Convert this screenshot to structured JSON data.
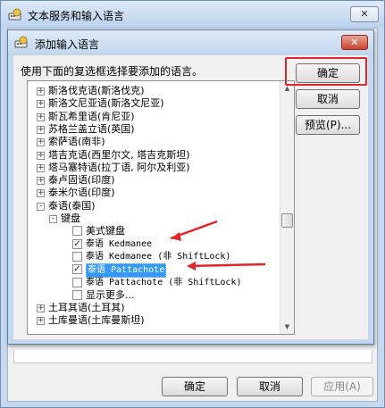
{
  "outer_window": {
    "title": "文本服务和输入语言",
    "close_glyph": "✕",
    "buttons": {
      "ok": "确定",
      "cancel": "取消",
      "apply": "应用(A)"
    }
  },
  "dialog": {
    "title": "添加输入语言",
    "close_glyph": "✕",
    "instruction": "使用下面的复选框选择要添加的语言。",
    "buttons": {
      "ok": "确定",
      "cancel": "取消",
      "preview": "预览(P)..."
    },
    "tree": [
      {
        "label": "斯洛伐克语(斯洛伐克)",
        "level": 0,
        "expander": "+"
      },
      {
        "label": "斯洛文尼亚语(斯洛文尼亚)",
        "level": 0,
        "expander": "+"
      },
      {
        "label": "斯瓦希里语(肯尼亚)",
        "level": 0,
        "expander": "+"
      },
      {
        "label": "苏格兰盖立语(英国)",
        "level": 0,
        "expander": "+"
      },
      {
        "label": "索萨语(南非)",
        "level": 0,
        "expander": "+"
      },
      {
        "label": "塔吉克语(西里尔文, 塔吉克斯坦)",
        "level": 0,
        "expander": "+"
      },
      {
        "label": "塔马塞特语(拉丁语, 阿尔及利亚)",
        "level": 0,
        "expander": "+"
      },
      {
        "label": "泰卢固语(印度)",
        "level": 0,
        "expander": "+"
      },
      {
        "label": "泰米尔语(印度)",
        "level": 0,
        "expander": "+"
      },
      {
        "label": "泰语(泰国)",
        "level": 0,
        "expander": "-"
      },
      {
        "label": "键盘",
        "level": 1,
        "expander": "-"
      },
      {
        "label": "美式键盘",
        "level": 2,
        "checked": false
      },
      {
        "label": "泰语 Kedmanee",
        "level": 2,
        "checked": true
      },
      {
        "label": "泰语 Kedmanee (非 ShiftLock)",
        "level": 2,
        "checked": false
      },
      {
        "label": "泰语 Pattachote",
        "level": 2,
        "checked": true,
        "selected": true
      },
      {
        "label": "泰语 Pattachote (非 ShiftLock)",
        "level": 2,
        "checked": false
      },
      {
        "label": "显示更多...",
        "level": 2,
        "checked": false
      },
      {
        "label": "土耳其语(土耳其)",
        "level": 0,
        "expander": "+"
      },
      {
        "label": "土库曼语(土库曼斯坦)",
        "level": 0,
        "expander": "+"
      }
    ]
  },
  "icons": {
    "window": "keyboard-globe-icon",
    "dialog": "keyboard-globe-icon",
    "scroll_up": "chevron-up-icon",
    "scroll_down": "chevron-down-icon"
  },
  "colors": {
    "highlight": "#e0262a",
    "selection": "#3399ff",
    "title_bar": "#c5d8ed",
    "close_button": "#c8452e"
  }
}
